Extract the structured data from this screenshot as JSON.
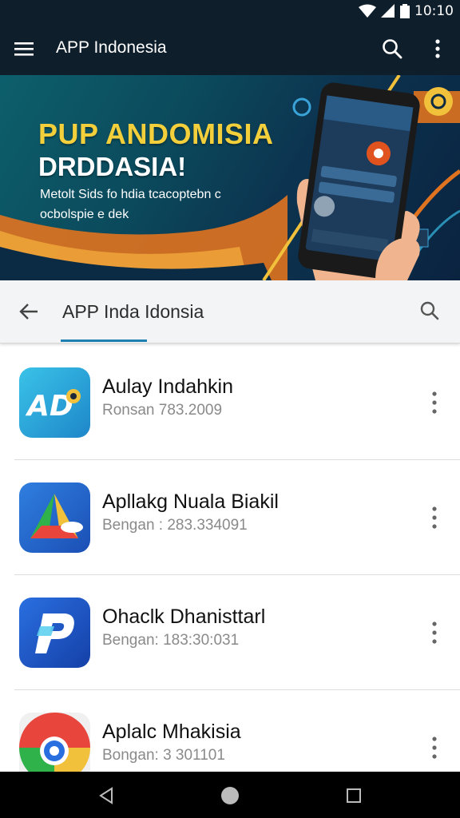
{
  "status_bar": {
    "time": "10:10"
  },
  "app_bar": {
    "title": "APP Indonesia"
  },
  "banner": {
    "headline": "PUP ANDOMISIA",
    "subheadline": "DRDDASIA!",
    "description": "Metolt Sids fo hdia tcacoptebn c ocbolspie e dek"
  },
  "search": {
    "query": "APP Inda Idonsia"
  },
  "apps": [
    {
      "name": "Aulay Indahkin",
      "meta": "Ronsan 783.2009",
      "icon": "app-ad-icon"
    },
    {
      "name": "Apllakg Nuala Biakil",
      "meta": "Bengan : 283.334091",
      "icon": "app-triangle-icon"
    },
    {
      "name": "Ohaclk Dhanisttarl",
      "meta": "Bengan: 183:30:031",
      "icon": "app-p-icon"
    },
    {
      "name": "Aplalc Mhakisia",
      "meta": "Bongan: 3 301101",
      "icon": "app-chrome-icon"
    }
  ],
  "colors": {
    "app_bar": "#0f1e2b",
    "accent": "#1f7fb0",
    "headline": "#f2cf3b"
  }
}
